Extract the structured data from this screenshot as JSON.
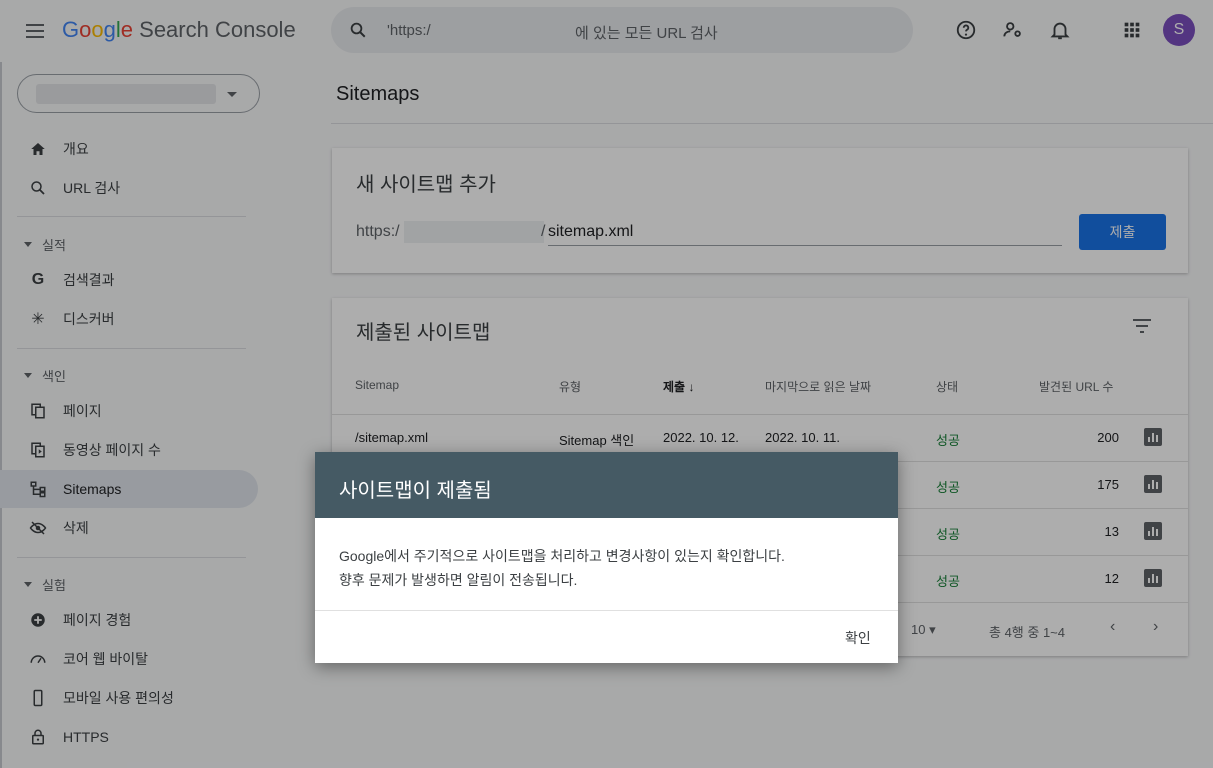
{
  "header": {
    "app_name_parts": [
      "G",
      "o",
      "o",
      "g",
      "l",
      "e"
    ],
    "app_name_suffix": "Search Console",
    "search_value": "'https:/",
    "search_placeholder": "에 있는 모든 URL 검사",
    "avatar_letter": "S"
  },
  "sidebar": {
    "nav": [
      {
        "label": "개요",
        "icon": "home-icon"
      },
      {
        "label": "URL 검사",
        "icon": "search-icon"
      }
    ],
    "sections": [
      {
        "title": "실적",
        "items": [
          {
            "label": "검색결과",
            "icon": "google-g-icon"
          },
          {
            "label": "디스커버",
            "icon": "asterisk-icon"
          }
        ]
      },
      {
        "title": "색인",
        "items": [
          {
            "label": "페이지",
            "icon": "pages-icon"
          },
          {
            "label": "동영상 페이지 수",
            "icon": "video-pages-icon"
          },
          {
            "label": "Sitemaps",
            "icon": "sitemap-icon",
            "active": true
          },
          {
            "label": "삭제",
            "icon": "eye-off-icon"
          }
        ]
      },
      {
        "title": "실험",
        "items": [
          {
            "label": "페이지 경험",
            "icon": "plus-circle-icon"
          },
          {
            "label": "코어 웹 바이탈",
            "icon": "gauge-icon"
          },
          {
            "label": "모바일 사용 편의성",
            "icon": "phone-icon"
          },
          {
            "label": "HTTPS",
            "icon": "lock-icon"
          }
        ]
      }
    ]
  },
  "main": {
    "title": "Sitemaps",
    "add_card": {
      "title": "새 사이트맵 추가",
      "prefix": "https:/",
      "slash": "/",
      "input_value": "sitemap.xml",
      "submit_label": "제출"
    },
    "list_card": {
      "title": "제출된 사이트맵",
      "columns": [
        "Sitemap",
        "유형",
        "제출",
        "마지막으로 읽은 날짜",
        "상태",
        "발견된 URL 수"
      ],
      "rows": [
        {
          "sitemap": "/sitemap.xml",
          "type": "Sitemap 색인",
          "submitted": "2022. 10. 12.",
          "last_read": "2022. 10. 11.",
          "status": "성공",
          "urls": "200"
        },
        {
          "sitemap": "",
          "type": "",
          "submitted": "",
          "last_read": "",
          "status": "성공",
          "urls": "175"
        },
        {
          "sitemap": "",
          "type": "",
          "submitted": "",
          "last_read": "",
          "status": "성공",
          "urls": "13"
        },
        {
          "sitemap": "",
          "type": "",
          "submitted": "",
          "last_read": "",
          "status": "성공",
          "urls": "12"
        }
      ],
      "rows_per_page": "10",
      "range_text": "총 4행 중 1~4"
    }
  },
  "dialog": {
    "title": "사이트맵이 제출됨",
    "body_line1": "Google에서 주기적으로 사이트맵을 처리하고 변경사항이 있는지 확인합니다.",
    "body_line2": "향후 문제가 발생하면 알림이 전송됩니다.",
    "ok_label": "확인"
  },
  "colors": {
    "accent": "#1a73e8",
    "success": "#188038",
    "dialog_header": "#455a64",
    "avatar": "#7b4fbf"
  }
}
